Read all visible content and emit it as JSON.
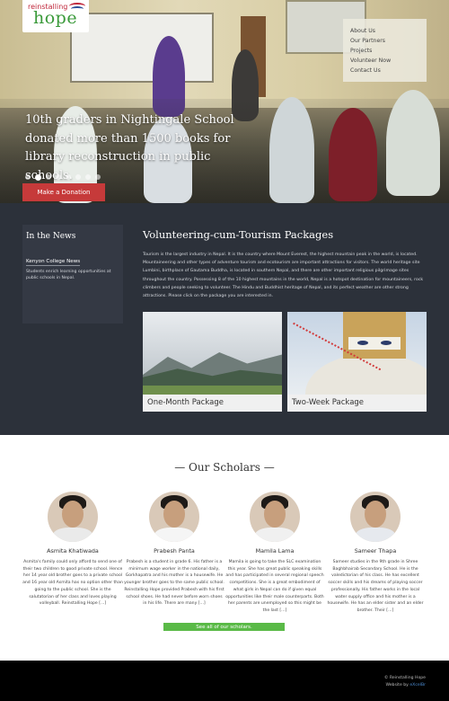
{
  "logo": {
    "line1": "reinstalling",
    "line2": "hope"
  },
  "nav": {
    "items": [
      "About Us",
      "Our Partners",
      "Projects",
      "Volunteer Now",
      "Contact Us"
    ]
  },
  "hero": {
    "caption": "10th graders in Nightingale School donated more than 1500 books for library reconstruction in public schools.",
    "slide_count": 8,
    "active_slide": 2,
    "donate_label": "Make a Donation"
  },
  "news": {
    "title": "In the News",
    "link": "Kenyon College News",
    "text": "Students enrich learning opportunities at public schools in Nepal."
  },
  "volunteer": {
    "title": "Volunteering-cum-Tourism Packages",
    "text": "Tourism is the largest industry in Nepal. It is the country where Mount Everest, the highest mountain peak in the world, is located. Mountaineering and other types of adventure tourism and ecotourism are important attractions for visitors. The world heritage site Lumbini, birthplace of Gautama Buddha, is located in southern Nepal, and there are other important religious pilgrimage sites throughout the country. Possessing 8 of the 10 highest mountains in the world, Nepal is a hotspot destination for mountaineers, rock climbers and people seeking to volunteer. The Hindu and Buddhist heritage of Nepal, and its perfect weather are other strong attractions. Please click on the package you are interested in.",
    "packages": [
      "One-Month Package",
      "Two-Week Package"
    ]
  },
  "scholars": {
    "title": "— Our Scholars —",
    "items": [
      {
        "name": "Asmita Khatiwada",
        "text": "Asmita's family could only afford to send one of their two children to good private school. Hence her 14 year old brother goes to a private school and 16 year old Asmita has no option other than going to the public school. She is the salutatorian of her class and loves playing volleyball. Reinstalling Hope [...]"
      },
      {
        "name": "Prabesh Panta",
        "text": "Prabesh is a student in grade 6. His father is a minimum wage worker in the national daily, Gorkhapatra and his mother is a housewife. He younger brother goes to the same public school. Reinstalling Hope provided Prabesh with his first school shoes. He had never before worn shoes in his life. There are many [...]"
      },
      {
        "name": "Mamila Lama",
        "text": "Mamila is going to take the SLC examination this year. She has great public speaking skills and has participated in several regional speech competitions. She is a great embodiment of what girls in Nepal can do if given equal opportunities like their male counterparts. Both her parents are unemployed so this might be the last [...]"
      },
      {
        "name": "Sameer Thapa",
        "text": "Sameer studies in the 9th grade in Shree Baghbhairab Secondary School. He is the valedictorian of his class. He has excellent soccer skills and his dreams of playing soccer professionally. His father works in the local water supply office and his mother is a housewife. He has an elder sister and an elder brother. Their [...]"
      }
    ],
    "see_all": "See all of our scholars."
  },
  "footer": {
    "copyright": "© Reinstalling Hope",
    "credit_prefix": "Website by",
    "credit_name": "eXcelBr"
  }
}
